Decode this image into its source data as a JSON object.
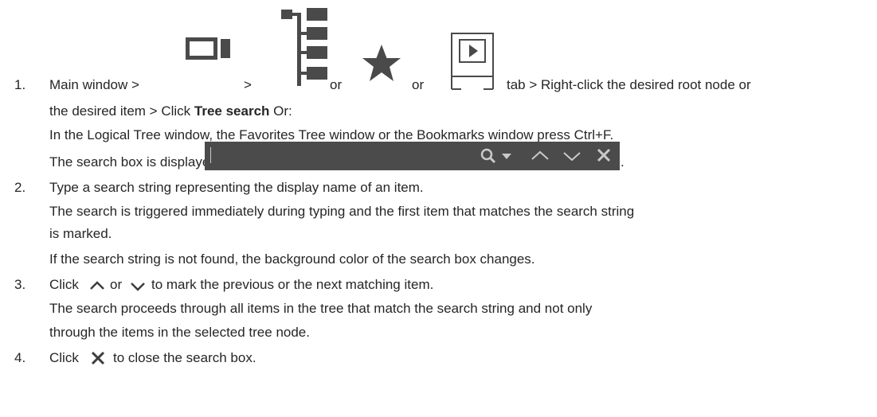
{
  "steps": [
    {
      "number": "1.",
      "line1": {
        "main_window": "Main window >",
        "sep": ">",
        "or1": "or",
        "or2": "or",
        "rest": "tab > Right-click the desired root node or"
      },
      "line2": {
        "pre": "the desired item > Click ",
        "bold": "Tree search",
        "post": " Or:"
      },
      "line3": "In the Logical Tree window, the Favorites Tree window or the Bookmarks window press Ctrl+F.",
      "line4": {
        "pre": "The search box is displayed",
        "post": "."
      }
    },
    {
      "number": "2.",
      "lines": [
        "Type a search string representing the display name of an item.",
        "The search is triggered immediately during typing and the first item that matches the search string",
        "is marked.",
        "If the search string is not found, the background color of the search box changes."
      ]
    },
    {
      "number": "3.",
      "line1": {
        "pre": "Click",
        "mid": "or",
        "post": "to mark the previous or the next matching item."
      },
      "lines": [
        "The search proceeds through all items in the tree that match the search string and not only",
        "through the items in the selected tree node."
      ]
    },
    {
      "number": "4.",
      "line1": {
        "pre": "Click",
        "post": "to close the search box."
      }
    }
  ],
  "icons": {
    "camera": "camera-view-icon",
    "tree": "logical-tree-icon",
    "star": "favorites-star-icon",
    "bookmarks": "bookmarks-play-icon",
    "search": "search-icon",
    "dropdown": "dropdown-arrow-icon",
    "up": "chevron-up-icon",
    "down": "chevron-down-icon",
    "close": "close-icon"
  },
  "colors": {
    "text": "#262626",
    "search_box_bg": "#4b4b4b",
    "search_box_fg": "#c9c9c9"
  }
}
